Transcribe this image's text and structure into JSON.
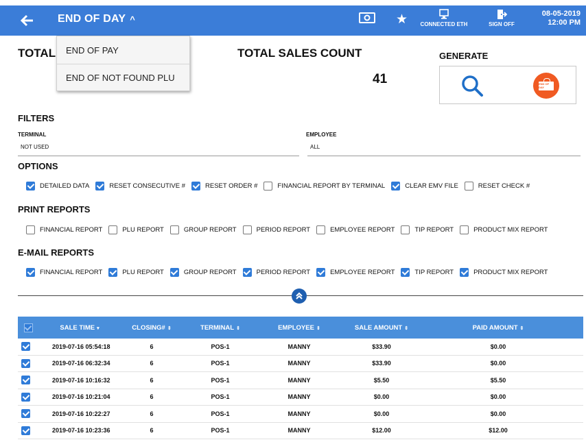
{
  "header": {
    "title": "END OF DAY",
    "connected_label": "CONNECTED ETH",
    "signoff_label": "SIGN OFF",
    "date": "08-05-2019",
    "time": "12:00 PM",
    "icons": [
      "back-arrow-icon",
      "cash-icon",
      "star-icon",
      "monitor-icon",
      "exit-door-icon"
    ]
  },
  "dropdown": {
    "items": [
      "END OF PAY",
      "END OF NOT FOUND PLU"
    ]
  },
  "summary": {
    "total_label": "TOTAL",
    "count_label": "TOTAL SALES COUNT",
    "count_value": "41",
    "generate_label": "GENERATE",
    "eod_sign_text": "END OF DAY"
  },
  "filters": {
    "title": "FILTERS",
    "terminal_label": "TERMINAL",
    "terminal_value": "NOT USED",
    "employee_label": "EMPLOYEE",
    "employee_value": "ALL"
  },
  "options": {
    "title": "OPTIONS",
    "items": [
      {
        "label": "DETAILED DATA",
        "checked": true
      },
      {
        "label": "RESET CONSECUTIVE #",
        "checked": true
      },
      {
        "label": "RESET ORDER #",
        "checked": true
      },
      {
        "label": "FINANCIAL REPORT BY TERMINAL",
        "checked": false
      },
      {
        "label": "CLEAR EMV FILE",
        "checked": true
      },
      {
        "label": "RESET CHECK #",
        "checked": false
      }
    ]
  },
  "print_reports": {
    "title": "PRINT REPORTS",
    "items": [
      {
        "label": "FINANCIAL REPORT",
        "checked": false
      },
      {
        "label": "PLU REPORT",
        "checked": false
      },
      {
        "label": "GROUP REPORT",
        "checked": false
      },
      {
        "label": "PERIOD REPORT",
        "checked": false
      },
      {
        "label": "EMPLOYEE REPORT",
        "checked": false
      },
      {
        "label": "TIP REPORT",
        "checked": false
      },
      {
        "label": "PRODUCT MIX REPORT",
        "checked": false
      }
    ]
  },
  "email_reports": {
    "title": "E-MAIL REPORTS",
    "items": [
      {
        "label": "FINANCIAL REPORT",
        "checked": true
      },
      {
        "label": "PLU REPORT",
        "checked": true
      },
      {
        "label": "GROUP REPORT",
        "checked": true
      },
      {
        "label": "PERIOD REPORT",
        "checked": true
      },
      {
        "label": "EMPLOYEE REPORT",
        "checked": true
      },
      {
        "label": "TIP REPORT",
        "checked": true
      },
      {
        "label": "PRODUCT MIX REPORT",
        "checked": true
      }
    ]
  },
  "table": {
    "columns": [
      "SALE TIME",
      "CLOSING#",
      "TERMINAL",
      "EMPLOYEE",
      "SALE AMOUNT",
      "PAID AMOUNT"
    ],
    "sort_markers": [
      "▾",
      "⇕",
      "⇕",
      "⇕",
      "⇕",
      "⇕"
    ],
    "rows": [
      {
        "checked": true,
        "cells": [
          "2019-07-16 05:54:18",
          "6",
          "POS-1",
          "MANNY",
          "$33.90",
          "$0.00"
        ]
      },
      {
        "checked": true,
        "cells": [
          "2019-07-16 06:32:34",
          "6",
          "POS-1",
          "MANNY",
          "$33.90",
          "$0.00"
        ]
      },
      {
        "checked": true,
        "cells": [
          "2019-07-16 10:16:32",
          "6",
          "POS-1",
          "MANNY",
          "$5.50",
          "$5.50"
        ]
      },
      {
        "checked": true,
        "cells": [
          "2019-07-16 10:21:04",
          "6",
          "POS-1",
          "MANNY",
          "$0.00",
          "$0.00"
        ]
      },
      {
        "checked": true,
        "cells": [
          "2019-07-16 10:22:27",
          "6",
          "POS-1",
          "MANNY",
          "$0.00",
          "$0.00"
        ]
      },
      {
        "checked": true,
        "cells": [
          "2019-07-16 10:23:36",
          "6",
          "POS-1",
          "MANNY",
          "$12.00",
          "$12.00"
        ]
      }
    ]
  },
  "colors": {
    "header_bg": "#3b7dd8",
    "table_header_bg": "#4a8fdb",
    "checkbox_on": "#2f7bd8",
    "eod_button": "#f05a22"
  }
}
